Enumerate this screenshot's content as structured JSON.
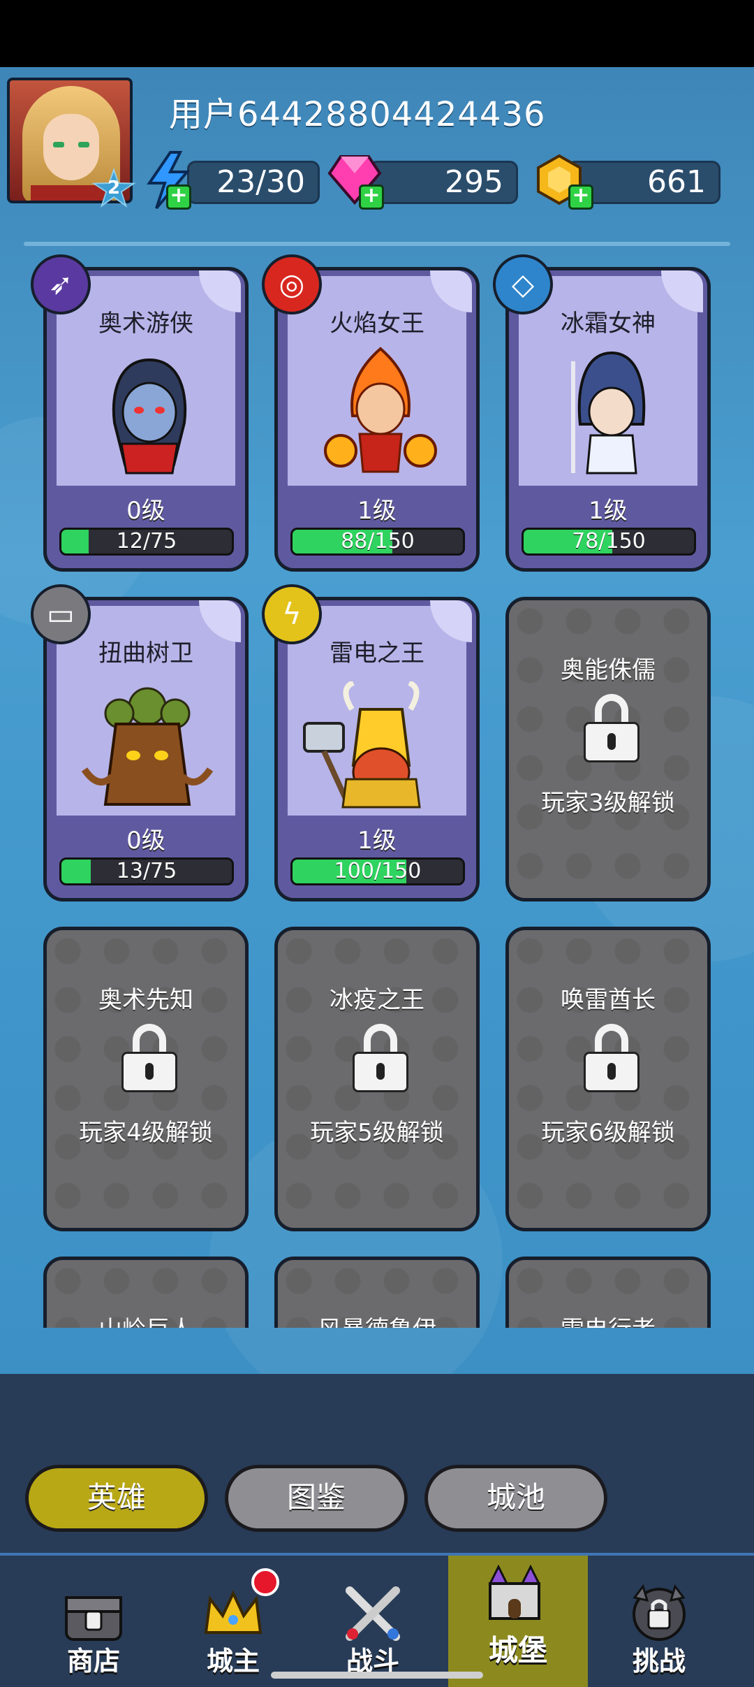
{
  "header": {
    "username": "用户64428804424436",
    "player_level": "2",
    "energy": "23/30",
    "gems": "295",
    "coins": "661"
  },
  "heroes": [
    {
      "name": "奥术游侠",
      "level": "0级",
      "progress": "12/75",
      "progress_value": 12,
      "progress_max": 75,
      "badge": "arrows-icon"
    },
    {
      "name": "火焰女王",
      "level": "1级",
      "progress": "88/150",
      "progress_value": 88,
      "progress_max": 150,
      "badge": "fire-ring-icon"
    },
    {
      "name": "冰霜女神",
      "level": "1级",
      "progress": "78/150",
      "progress_value": 78,
      "progress_max": 150,
      "badge": "ice-crystal-icon"
    },
    {
      "name": "扭曲树卫",
      "level": "0级",
      "progress": "13/75",
      "progress_value": 13,
      "progress_max": 75,
      "badge": "shield-plate-icon"
    },
    {
      "name": "雷电之王",
      "level": "1级",
      "progress": "100/150",
      "progress_value": 100,
      "progress_max": 150,
      "badge": "lightning-icon"
    }
  ],
  "locked_heroes": [
    {
      "name": "奥能侏儒",
      "unlock": "玩家3级解锁"
    },
    {
      "name": "奥术先知",
      "unlock": "玩家4级解锁"
    },
    {
      "name": "冰疫之王",
      "unlock": "玩家5级解锁"
    },
    {
      "name": "唤雷酋长",
      "unlock": "玩家6级解锁"
    },
    {
      "name": "山岭巨人",
      "unlock": ""
    },
    {
      "name": "风暴德鲁伊",
      "unlock": ""
    },
    {
      "name": "雷电行者",
      "unlock": ""
    }
  ],
  "tabs": {
    "heroes": "英雄",
    "codex": "图鉴",
    "city": "城池"
  },
  "nav": {
    "shop": "商店",
    "lord": "城主",
    "battle": "战斗",
    "castle": "城堡",
    "challenge": "挑战"
  },
  "colors": {
    "background": "#4a9ed0",
    "hero_card": "#5f5aa0",
    "locked_card": "#6b6b6d",
    "progress_fill": "#2fd35f",
    "active_tab": "#b9a816"
  }
}
